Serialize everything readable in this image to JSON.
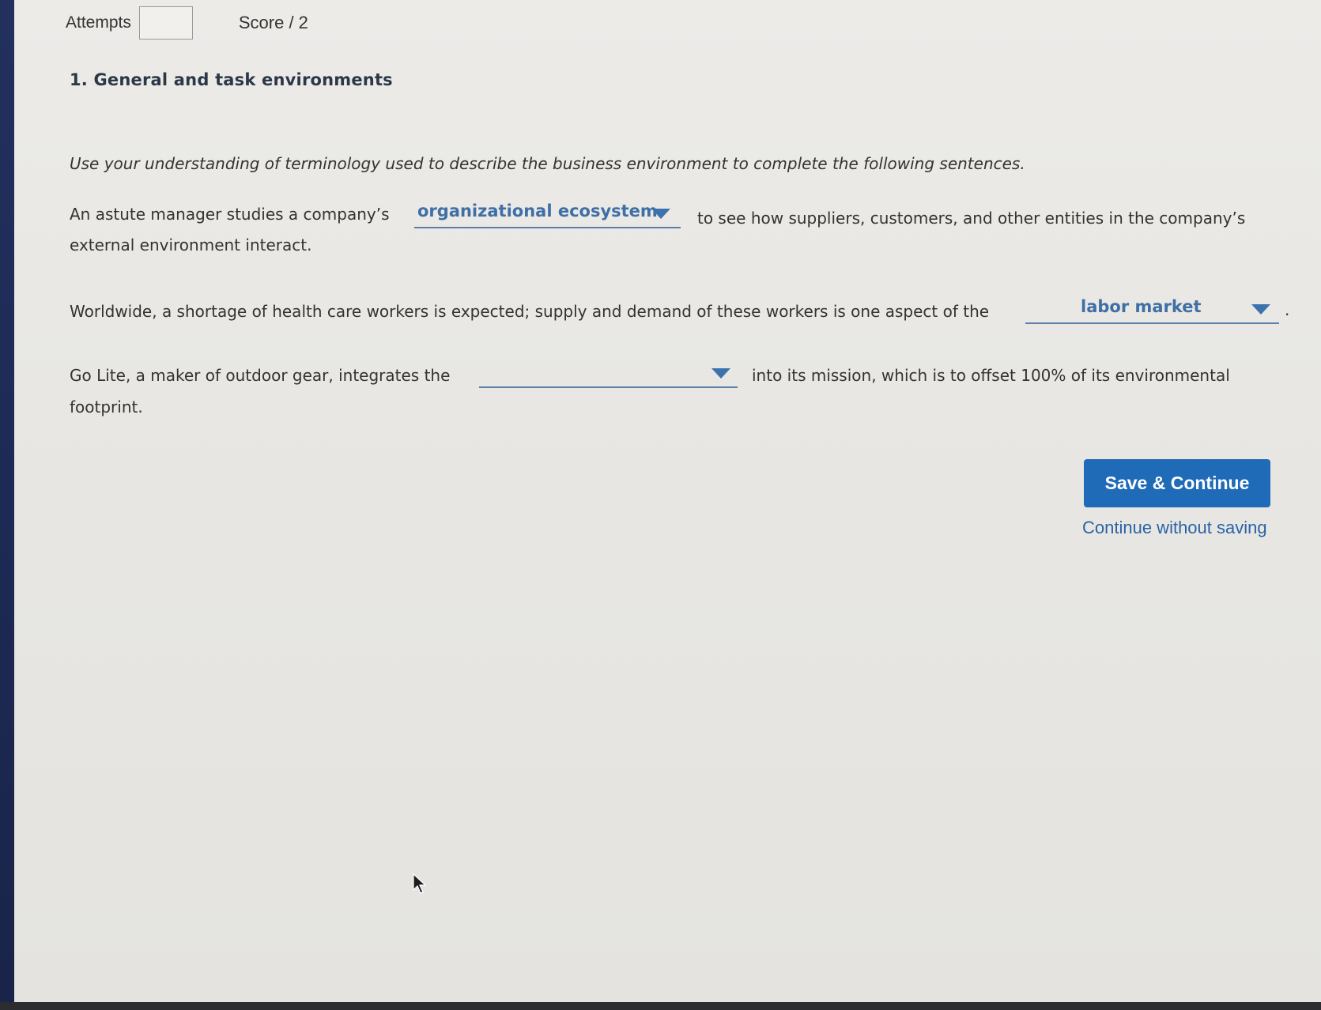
{
  "header": {
    "attempts_label": "Attempts",
    "attempts_value": "",
    "score_label": "Score / 2"
  },
  "question": {
    "title": "1. General and task environments",
    "instructions": "Use your understanding of terminology used to describe the business environment to complete the following sentences."
  },
  "sentences": [
    {
      "before": "An astute manager studies a company’s",
      "dropdown_value": "organizational ecosystem",
      "after": "to see how suppliers, customers, and other entities in the company’s",
      "continuation": "external environment interact."
    },
    {
      "before": "Worldwide, a shortage of health care workers is expected; supply and demand of these workers is one aspect of the",
      "dropdown_value": "labor market",
      "after": "."
    },
    {
      "before": "Go Lite, a maker of outdoor gear, integrates the",
      "dropdown_value": "",
      "after": "into its mission, which is to offset 100% of its environmental",
      "continuation": "footprint."
    }
  ],
  "actions": {
    "save_continue_label": "Save & Continue",
    "continue_without_saving_label": "Continue without saving"
  },
  "colors": {
    "accent": "#1f6bb8",
    "dropdown_text": "#3f6fa5",
    "dropdown_underline": "#5c7fa8"
  }
}
